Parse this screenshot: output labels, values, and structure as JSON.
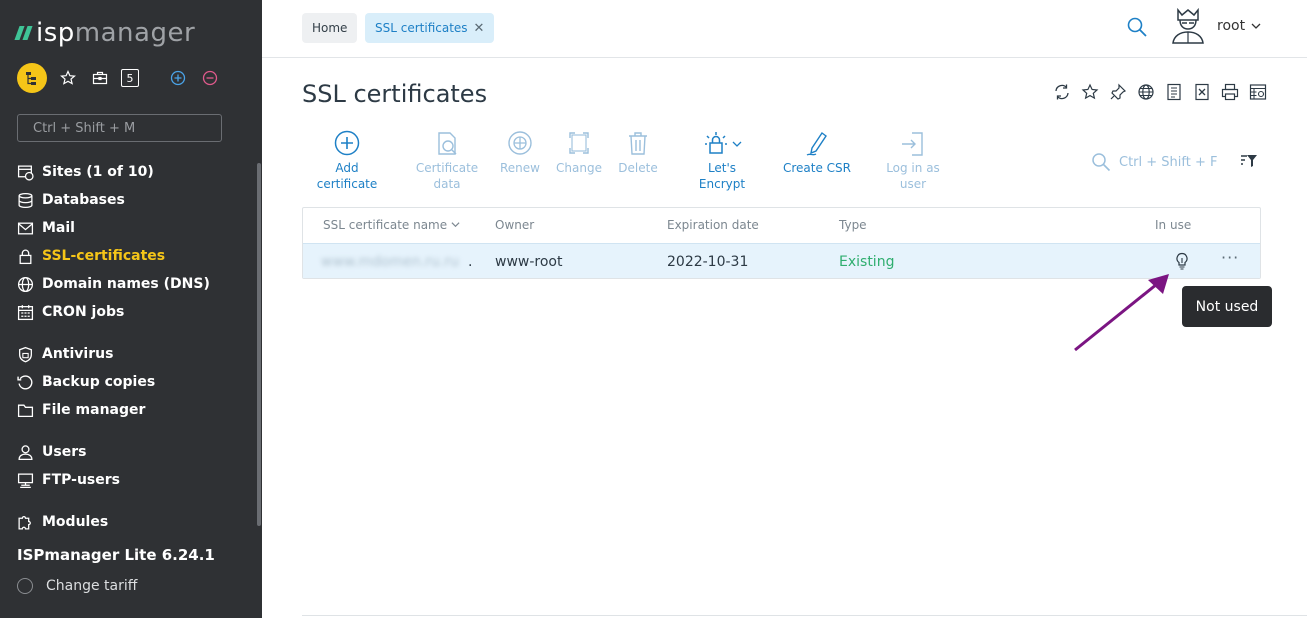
{
  "logo": {
    "part1": "isp",
    "part2": "manager"
  },
  "sidebar": {
    "search_placeholder": "Ctrl + Shift + M",
    "items": [
      {
        "label": "Sites (1 of 10)",
        "icon": "sites-icon"
      },
      {
        "label": "Databases",
        "icon": "database-icon"
      },
      {
        "label": "Mail",
        "icon": "mail-icon"
      },
      {
        "label": "SSL-certificates",
        "icon": "lock-icon",
        "active": true
      },
      {
        "label": "Domain names (DNS)",
        "icon": "globe-icon"
      },
      {
        "label": "CRON jobs",
        "icon": "calendar-icon"
      },
      {
        "label": "Antivirus",
        "icon": "shield-icon"
      },
      {
        "label": "Backup copies",
        "icon": "backup-icon"
      },
      {
        "label": "File manager",
        "icon": "folder-icon"
      },
      {
        "label": "Users",
        "icon": "user-icon"
      },
      {
        "label": "FTP-users",
        "icon": "ftp-icon"
      },
      {
        "label": "Modules",
        "icon": "puzzle-icon"
      }
    ],
    "quick_badge": "5",
    "version": "ISPmanager Lite 6.24.1",
    "change_tariff": "Change tariff"
  },
  "breadcrumb": {
    "home": "Home",
    "current": "SSL certificates",
    "close_glyph": "✕"
  },
  "user": {
    "name": "root"
  },
  "page": {
    "title": "SSL certificates"
  },
  "toolbar": [
    {
      "label": "Add certificate",
      "enabled": true
    },
    {
      "label": "Certificate data",
      "enabled": false
    },
    {
      "label": "Renew",
      "enabled": false
    },
    {
      "label": "Change",
      "enabled": false
    },
    {
      "label": "Delete",
      "enabled": false
    },
    {
      "label": "Let's Encrypt",
      "enabled": true
    },
    {
      "label": "Create CSR",
      "enabled": true
    },
    {
      "label": "Log in as user",
      "enabled": false
    }
  ],
  "grid_search": {
    "placeholder": "Ctrl + Shift + F"
  },
  "table": {
    "columns": [
      "SSL certificate name",
      "Owner",
      "Expiration date",
      "Type",
      "In use"
    ],
    "rows": [
      {
        "name": "www.mdomen.ru.ru",
        "owner": "www-root",
        "expiration": "2022-10-31",
        "type": "Existing",
        "in_use": "bulb-icon",
        "actions": "···"
      }
    ]
  },
  "tooltip": "Not used",
  "colors": {
    "accent": "#1e80c6",
    "active_nav": "#f5c518",
    "existing": "#2fae6f",
    "annotation_arrow": "#7b1582"
  }
}
